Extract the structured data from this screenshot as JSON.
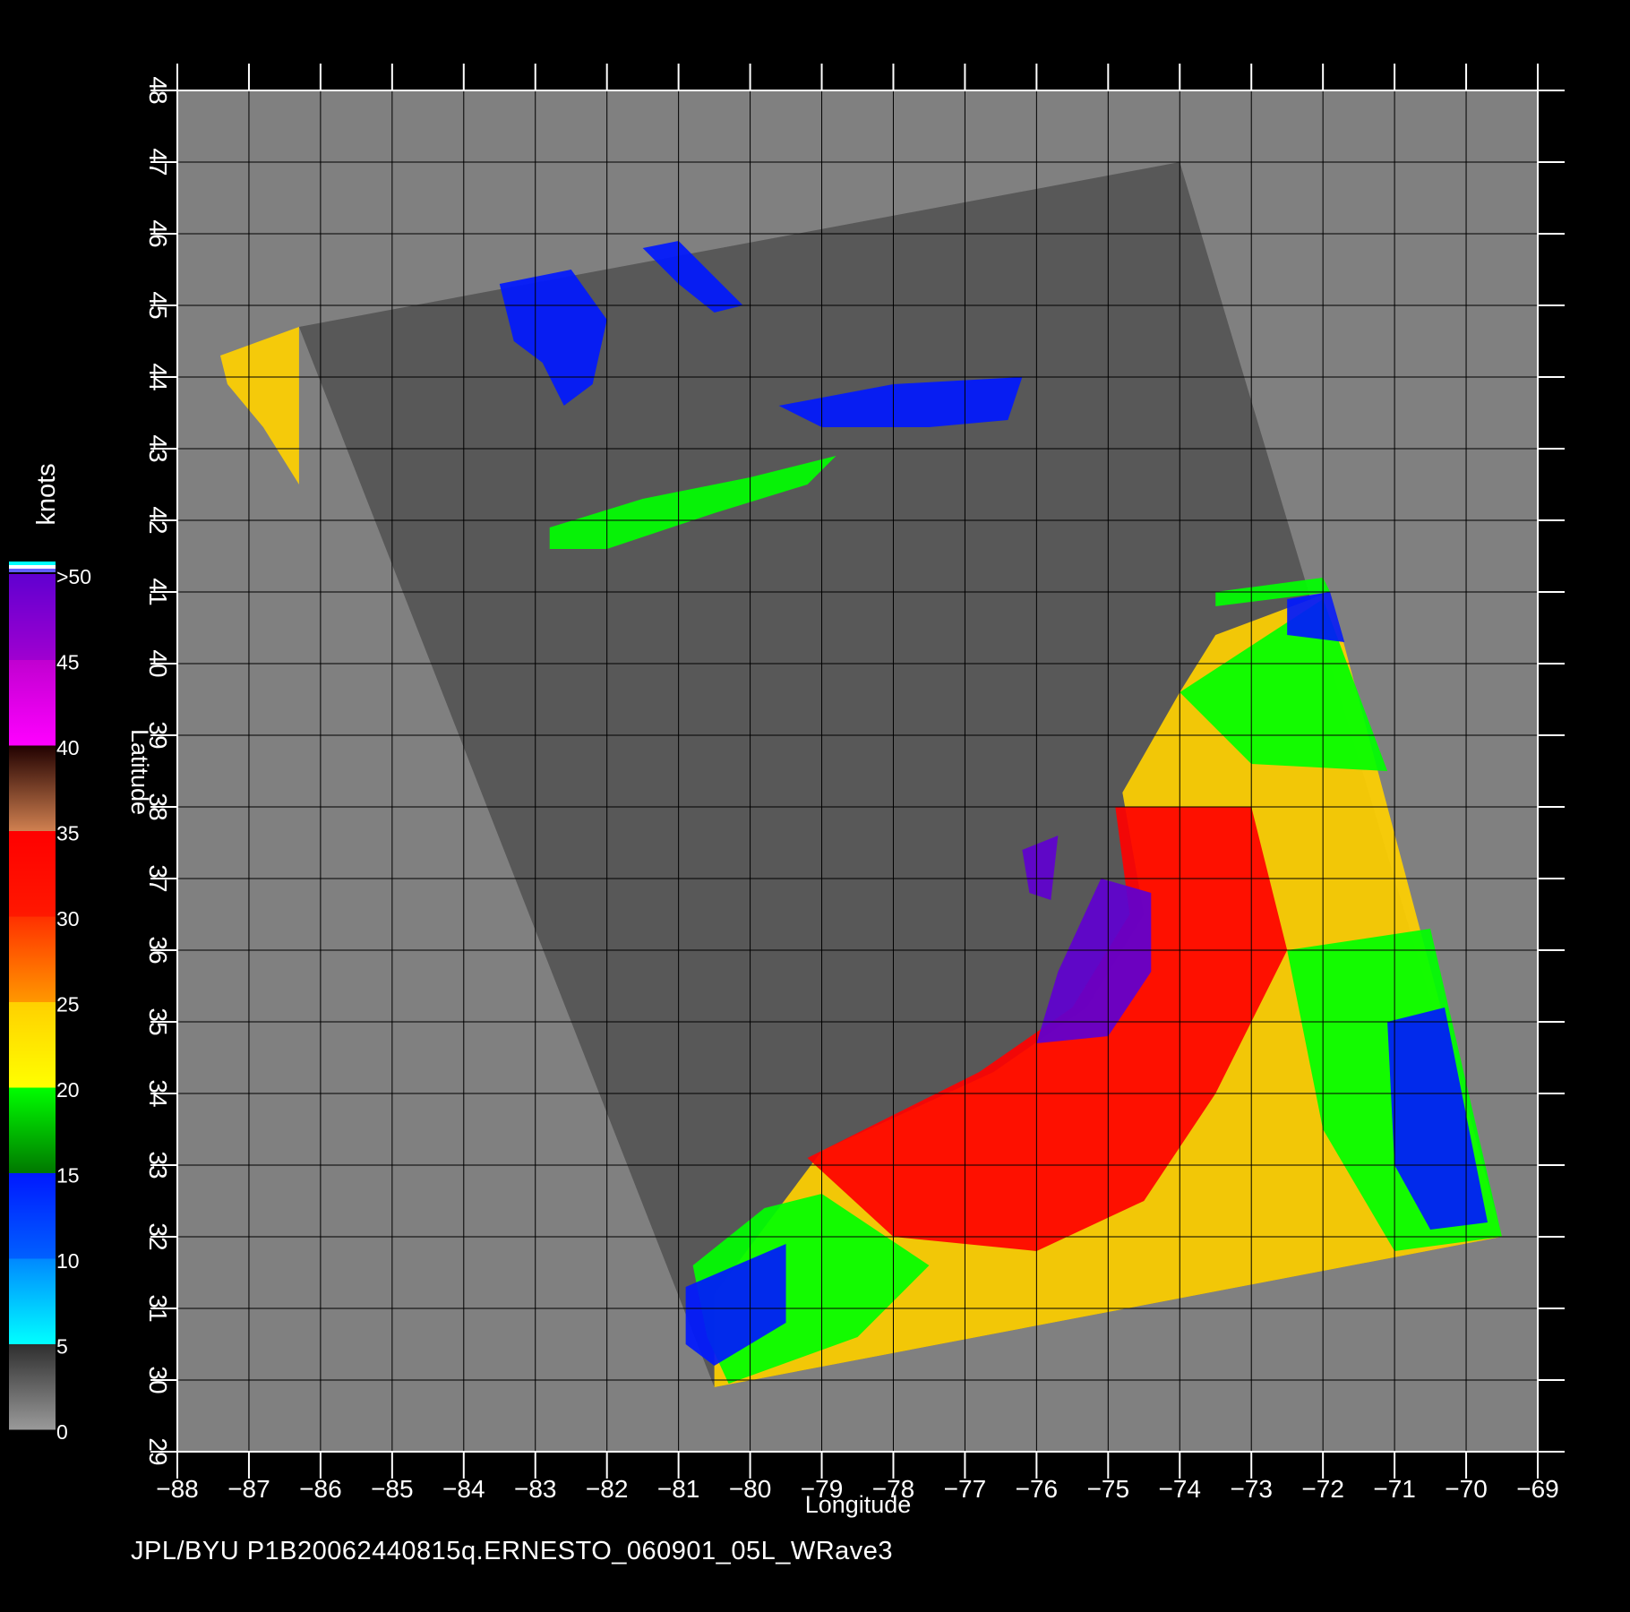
{
  "footer_text": "JPL/BYU  P1B20062440815q.ERNESTO_060901_05L_WRave3",
  "colorbar": {
    "title": "knots",
    "labels": [
      "0",
      "5",
      "10",
      "15",
      "20",
      "25",
      "30",
      "35",
      "40",
      "45",
      ">50"
    ],
    "bands": [
      {
        "from": 0,
        "to": 5,
        "top": "#2e2e2e",
        "bottom": "#9a9a9a"
      },
      {
        "from": 5,
        "to": 10,
        "top": "#0088ff",
        "bottom": "#00ffff"
      },
      {
        "from": 10,
        "to": 15,
        "top": "#0018ff",
        "bottom": "#0060ff"
      },
      {
        "from": 15,
        "to": 20,
        "top": "#00ff00",
        "bottom": "#007800"
      },
      {
        "from": 20,
        "to": 25,
        "top": "#ffd000",
        "bottom": "#ffff00"
      },
      {
        "from": 25,
        "to": 30,
        "top": "#ff3000",
        "bottom": "#ff9800"
      },
      {
        "from": 30,
        "to": 35,
        "top": "#ff0000",
        "bottom": "#ff1800"
      },
      {
        "from": 35,
        "to": 40,
        "top": "#200000",
        "bottom": "#d08050"
      },
      {
        "from": 40,
        "to": 45,
        "top": "#c000d0",
        "bottom": "#ff00ff"
      },
      {
        "from": 45,
        "to": 50,
        "top": "#6000d0",
        "bottom": "#a000d0"
      }
    ],
    "cap_colors": [
      "#00ffff",
      "#ffffff",
      "#6060ff"
    ]
  },
  "chart_data": {
    "type": "heatmap",
    "xlabel": "Longitude",
    "ylabel": "Latitude",
    "xlim": [
      -88,
      -69
    ],
    "ylim": [
      29,
      48
    ],
    "x_ticks": [
      "-88",
      "-87",
      "-86",
      "-85",
      "-84",
      "-83",
      "-82",
      "-81",
      "-80",
      "-79",
      "-78",
      "-77",
      "-76",
      "-75",
      "-74",
      "-73",
      "-72",
      "-71",
      "-70",
      "-69"
    ],
    "y_ticks": [
      "29",
      "30",
      "31",
      "32",
      "33",
      "34",
      "35",
      "36",
      "37",
      "38",
      "39",
      "40",
      "41",
      "42",
      "43",
      "44",
      "45",
      "46",
      "47",
      "48"
    ],
    "grid": true,
    "colors": {
      "background": "#808080",
      "swath_land": "#585858",
      "grid": "#000000"
    },
    "swath_corners": [
      [
        -86.3,
        44.7
      ],
      [
        -74.0,
        47.0
      ],
      [
        -69.5,
        32.0
      ],
      [
        -80.5,
        29.9
      ]
    ],
    "wind_regions": [
      {
        "speed": 23,
        "polygon": [
          [
            -80.5,
            31.2
          ],
          [
            -79.0,
            33.2
          ],
          [
            -76.6,
            34.3
          ],
          [
            -75.3,
            35.2
          ],
          [
            -74.5,
            36.5
          ],
          [
            -74.8,
            38.2
          ],
          [
            -74.0,
            39.6
          ],
          [
            -73.5,
            40.4
          ],
          [
            -71.9,
            41.0
          ],
          [
            -69.5,
            32.0
          ],
          [
            -80.5,
            29.9
          ]
        ]
      },
      {
        "speed": 31,
        "polygon": [
          [
            -79.2,
            33.1
          ],
          [
            -76.8,
            34.3
          ],
          [
            -75.5,
            35.2
          ],
          [
            -74.7,
            36.5
          ],
          [
            -74.9,
            38.0
          ],
          [
            -73.0,
            38.0
          ],
          [
            -72.5,
            36.0
          ],
          [
            -73.5,
            34.0
          ],
          [
            -74.5,
            32.5
          ],
          [
            -76.0,
            31.8
          ],
          [
            -78.0,
            32.0
          ]
        ]
      },
      {
        "speed": 18,
        "polygon": [
          [
            -80.6,
            30.6
          ],
          [
            -80.8,
            31.6
          ],
          [
            -79.8,
            32.4
          ],
          [
            -79.0,
            32.6
          ],
          [
            -77.5,
            31.6
          ],
          [
            -78.5,
            30.6
          ],
          [
            -80.3,
            29.95
          ]
        ]
      },
      {
        "speed": 11,
        "polygon": [
          [
            -80.9,
            31.3
          ],
          [
            -79.5,
            31.9
          ],
          [
            -79.5,
            30.8
          ],
          [
            -80.5,
            30.2
          ],
          [
            -80.9,
            30.5
          ]
        ]
      },
      {
        "speed": 17,
        "polygon": [
          [
            -72.5,
            36.0
          ],
          [
            -70.5,
            36.3
          ],
          [
            -69.5,
            32.0
          ],
          [
            -71.0,
            31.8
          ],
          [
            -72.0,
            33.5
          ]
        ]
      },
      {
        "speed": 12,
        "polygon": [
          [
            -71.1,
            35.0
          ],
          [
            -70.3,
            35.2
          ],
          [
            -69.7,
            32.2
          ],
          [
            -70.5,
            32.1
          ],
          [
            -71.0,
            33.0
          ]
        ]
      },
      {
        "speed": 17,
        "polygon": [
          [
            -74.0,
            39.6
          ],
          [
            -72.0,
            40.9
          ],
          [
            -71.1,
            38.5
          ],
          [
            -73.0,
            38.6
          ]
        ]
      },
      {
        "speed": 12,
        "polygon": [
          [
            -72.5,
            40.9
          ],
          [
            -71.9,
            41.0
          ],
          [
            -71.7,
            40.3
          ],
          [
            -72.5,
            40.4
          ]
        ]
      },
      {
        "speed": 45,
        "polygon": [
          [
            -75.1,
            37.0
          ],
          [
            -74.4,
            36.8
          ],
          [
            -74.4,
            35.7
          ],
          [
            -75.0,
            34.8
          ],
          [
            -76.0,
            34.7
          ],
          [
            -75.7,
            35.7
          ]
        ]
      },
      {
        "speed": 45,
        "polygon": [
          [
            -76.2,
            37.4
          ],
          [
            -75.7,
            37.6
          ],
          [
            -75.8,
            36.7
          ],
          [
            -76.1,
            36.8
          ]
        ]
      },
      {
        "speed": 12,
        "polygon": [
          [
            -83.5,
            45.3
          ],
          [
            -82.5,
            45.5
          ],
          [
            -82.0,
            44.8
          ],
          [
            -82.2,
            43.9
          ],
          [
            -82.6,
            43.6
          ],
          [
            -82.9,
            44.2
          ],
          [
            -83.3,
            44.5
          ]
        ]
      },
      {
        "speed": 12,
        "polygon": [
          [
            -81.5,
            45.8
          ],
          [
            -81.0,
            45.9
          ],
          [
            -80.1,
            45.0
          ],
          [
            -80.5,
            44.9
          ],
          [
            -81.0,
            45.3
          ]
        ]
      },
      {
        "speed": 12,
        "polygon": [
          [
            -79.6,
            43.6
          ],
          [
            -78.0,
            43.9
          ],
          [
            -76.2,
            44.0
          ],
          [
            -76.4,
            43.4
          ],
          [
            -77.5,
            43.3
          ],
          [
            -79.0,
            43.3
          ]
        ]
      },
      {
        "speed": 17,
        "polygon": [
          [
            -82.8,
            41.9
          ],
          [
            -81.5,
            42.3
          ],
          [
            -80.0,
            42.6
          ],
          [
            -78.8,
            42.9
          ],
          [
            -79.2,
            42.5
          ],
          [
            -80.5,
            42.1
          ],
          [
            -82.0,
            41.6
          ],
          [
            -82.8,
            41.6
          ]
        ]
      },
      {
        "speed": 20,
        "polygon": [
          [
            -87.4,
            44.3
          ],
          [
            -86.3,
            44.7
          ],
          [
            -86.3,
            42.5
          ],
          [
            -86.8,
            43.3
          ],
          [
            -87.3,
            43.9
          ]
        ]
      },
      {
        "speed": 17,
        "polygon": [
          [
            -73.5,
            41.0
          ],
          [
            -72.0,
            41.2
          ],
          [
            -71.9,
            41.0
          ],
          [
            -73.5,
            40.8
          ]
        ]
      }
    ]
  }
}
